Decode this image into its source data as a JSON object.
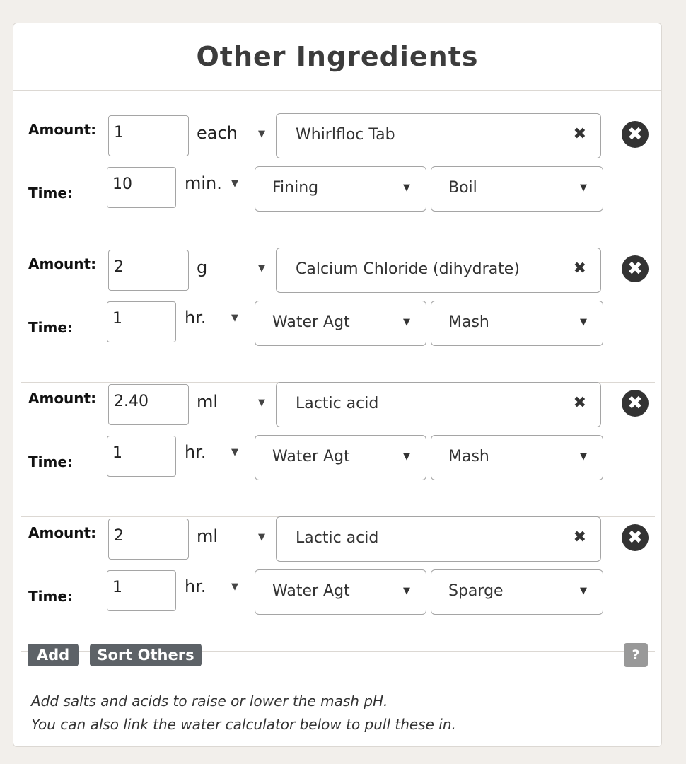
{
  "panel": {
    "title": "Other Ingredients",
    "amount_label": "Amount:",
    "time_label": "Time:"
  },
  "ingredients": [
    {
      "amount": "1",
      "amount_unit": "each",
      "name": "Whirlfloc Tab",
      "time": "10",
      "time_unit": "min.",
      "type": "Fining",
      "use": "Boil"
    },
    {
      "amount": "2",
      "amount_unit": "g",
      "name": "Calcium Chloride (dihydrate)",
      "time": "1",
      "time_unit": "hr.",
      "type": "Water Agt",
      "use": "Mash"
    },
    {
      "amount": "2.40",
      "amount_unit": "ml",
      "name": "Lactic acid",
      "time": "1",
      "time_unit": "hr.",
      "type": "Water Agt",
      "use": "Mash"
    },
    {
      "amount": "2",
      "amount_unit": "ml",
      "name": "Lactic acid",
      "time": "1",
      "time_unit": "hr.",
      "type": "Water Agt",
      "use": "Sparge"
    }
  ],
  "icons": {
    "caret": "▼",
    "clear": "✖",
    "remove": "✖"
  },
  "actions": {
    "add_label": "Add",
    "sort_label": "Sort Others",
    "help_label": "?"
  },
  "note": {
    "line1": "Add salts and acids to raise or lower the mash pH.",
    "line2": "You can also link the water calculator below to pull these in."
  }
}
